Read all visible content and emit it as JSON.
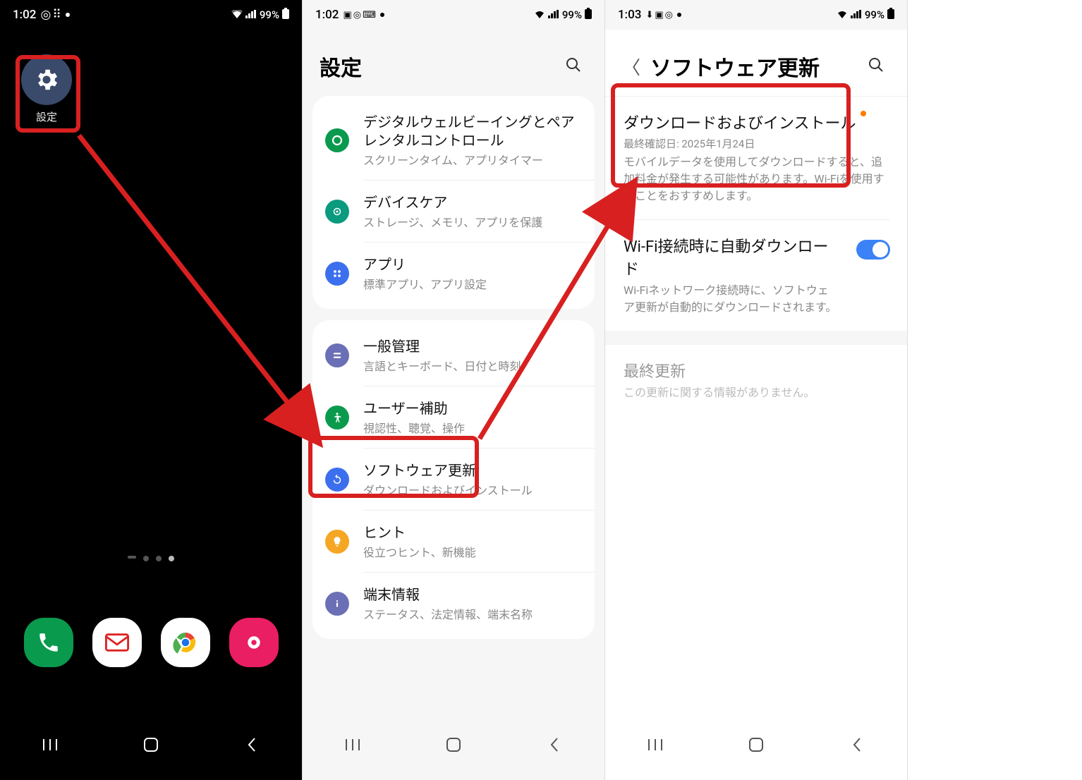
{
  "phone1": {
    "status": {
      "time": "1:02",
      "battery": "99%"
    },
    "home": {
      "settings_label": "設定"
    }
  },
  "phone2": {
    "status": {
      "time": "1:02",
      "battery": "99%"
    },
    "header": {
      "title": "設定"
    },
    "items": {
      "wellbeing": {
        "title": "デジタルウェルビーイングとペアレンタルコントロール",
        "sub": "スクリーンタイム、アプリタイマー"
      },
      "devicecare": {
        "title": "デバイスケア",
        "sub": "ストレージ、メモリ、アプリを保護"
      },
      "apps": {
        "title": "アプリ",
        "sub": "標準アプリ、アプリ設定"
      },
      "general": {
        "title": "一般管理",
        "sub": "言語とキーボード、日付と時刻"
      },
      "accessibility": {
        "title": "ユーザー補助",
        "sub": "視認性、聴覚、操作"
      },
      "update": {
        "title": "ソフトウェア更新",
        "sub": "ダウンロードおよびインストール"
      },
      "tips": {
        "title": "ヒント",
        "sub": "役立つヒント、新機能"
      },
      "about": {
        "title": "端末情報",
        "sub": "ステータス、法定情報、端末名称"
      }
    }
  },
  "phone3": {
    "status": {
      "time": "1:03",
      "battery": "99%"
    },
    "header": {
      "title": "ソフトウェア更新"
    },
    "download": {
      "title": "ダウンロードおよびインストール",
      "meta": "最終確認日: 2025年1月24日",
      "desc": "モバイルデータを使用してダウンロードすると、追加料金が発生する可能性があります。Wi-Fiを使用することをおすすめします。"
    },
    "autodl": {
      "title": "Wi-Fi接続時に自動ダウンロード",
      "desc": "Wi-Fiネットワーク接続時に、ソフトウェア更新が自動的にダウンロードされます。"
    },
    "last": {
      "title": "最終更新",
      "desc": "この更新に関する情報がありません。"
    }
  }
}
